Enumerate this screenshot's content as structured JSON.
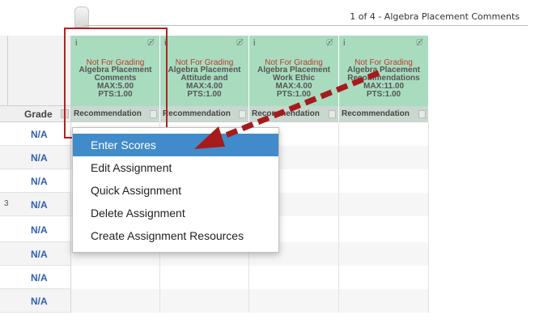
{
  "pager": {
    "text": "1 of 4 - Algebra Placement Comments"
  },
  "grid": {
    "grade_header": "Grade",
    "columns": [
      {
        "info": "i",
        "status": "Not For Grading",
        "title": "Algebra Placement Comments",
        "max": "MAX:5.00",
        "pts": "PTS:1.00",
        "sub": "Recommendation"
      },
      {
        "info": "i",
        "status": "Not For Grading",
        "title": "Algebra Placement Attitude and",
        "max": "MAX:4.00",
        "pts": "PTS:1.00",
        "sub": "Recommendation"
      },
      {
        "info": "i",
        "status": "Not For Grading",
        "title": "Algebra Placement Work Ethic",
        "max": "MAX:4.00",
        "pts": "PTS:1.00",
        "sub": "Recommendation"
      },
      {
        "info": "i",
        "status": "Not For Grading",
        "title": "Algebra Placement Recommendations",
        "max": "MAX:11.00",
        "pts": "PTS:1.00",
        "sub": "Recommendation"
      }
    ],
    "rows": [
      {
        "grade": "N/A"
      },
      {
        "grade": "N/A"
      },
      {
        "grade": "N/A"
      },
      {
        "grade": "N/A",
        "marker": "3"
      },
      {
        "grade": "N/A"
      },
      {
        "grade": "N/A"
      },
      {
        "grade": "N/A"
      },
      {
        "grade": "N/A"
      }
    ]
  },
  "context_menu": {
    "items": [
      {
        "label": "Enter Scores",
        "active": true
      },
      {
        "label": "Edit Assignment"
      },
      {
        "label": "Quick Assignment"
      },
      {
        "label": "Delete Assignment"
      },
      {
        "label": "Create Assignment Resources"
      }
    ]
  },
  "colors": {
    "header_green": "#a9dcbf",
    "not_for_grading": "#c0392b",
    "menu_active": "#428bca",
    "annotation_red": "#b22222",
    "grade_blue": "#2f5fb3"
  },
  "icons": {
    "column_visibility": "eye-slash-icon",
    "column_info": "info-icon",
    "sort": "sort-icon"
  }
}
